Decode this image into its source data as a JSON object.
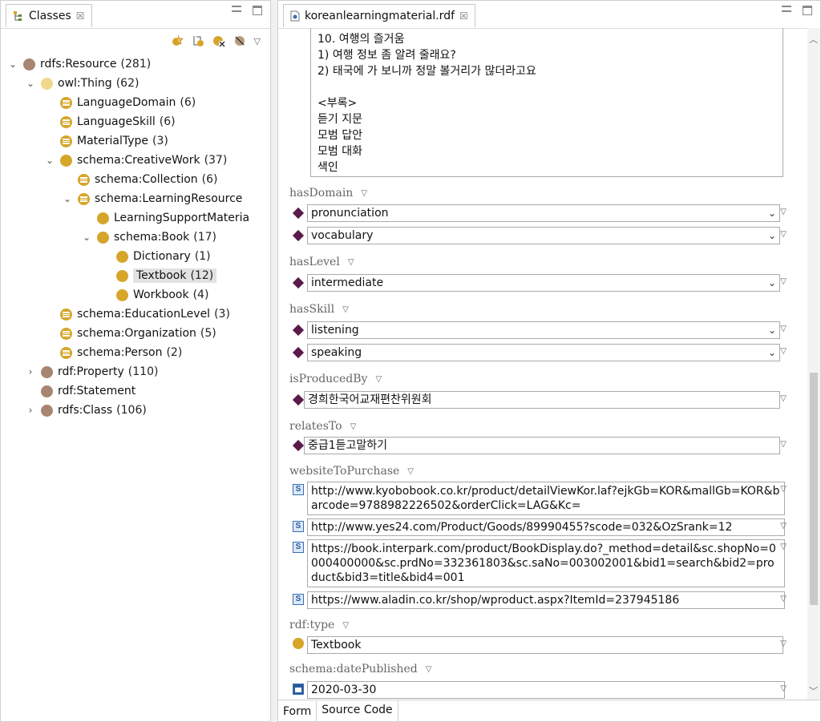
{
  "left_panel": {
    "tab_title": "Classes",
    "tab_close": "☒",
    "tree": [
      {
        "label": "rdfs:Resource",
        "count": "(281)",
        "twisty": "⌄",
        "icon": "brown",
        "depth": 0
      },
      {
        "label": "owl:Thing",
        "count": "(62)",
        "twisty": "⌄",
        "icon": "lightgold",
        "depth": 1
      },
      {
        "label": "LanguageDomain",
        "count": "(6)",
        "twisty": "",
        "icon": "list",
        "depth": 2
      },
      {
        "label": "LanguageSkill",
        "count": "(6)",
        "twisty": "",
        "icon": "list",
        "depth": 2
      },
      {
        "label": "MaterialType",
        "count": "(3)",
        "twisty": "",
        "icon": "list",
        "depth": 2
      },
      {
        "label": "schema:CreativeWork",
        "count": "(37)",
        "twisty": "⌄",
        "icon": "gold",
        "depth": 2
      },
      {
        "label": "schema:Collection",
        "count": "(6)",
        "twisty": "",
        "icon": "list",
        "depth": 3
      },
      {
        "label": "schema:LearningResource",
        "count": "",
        "twisty": "⌄",
        "icon": "list",
        "depth": 3
      },
      {
        "label": "LearningSupportMateria",
        "count": "",
        "twisty": "",
        "icon": "gold",
        "depth": 4
      },
      {
        "label": "schema:Book",
        "count": "(17)",
        "twisty": "⌄",
        "icon": "gold",
        "depth": 4
      },
      {
        "label": "Dictionary",
        "count": "(1)",
        "twisty": "",
        "icon": "gold",
        "depth": 5
      },
      {
        "label": "Textbook",
        "count": "(12)",
        "twisty": "",
        "icon": "gold",
        "depth": 5,
        "selected": true
      },
      {
        "label": "Workbook",
        "count": "(4)",
        "twisty": "",
        "icon": "gold",
        "depth": 5
      },
      {
        "label": "schema:EducationLevel",
        "count": "(3)",
        "twisty": "",
        "icon": "list",
        "depth": 2
      },
      {
        "label": "schema:Organization",
        "count": "(5)",
        "twisty": "",
        "icon": "list",
        "depth": 2
      },
      {
        "label": "schema:Person",
        "count": "(2)",
        "twisty": "",
        "icon": "list",
        "depth": 2
      },
      {
        "label": "rdf:Property",
        "count": "(110)",
        "twisty": "›",
        "icon": "brown",
        "depth": 1
      },
      {
        "label": "rdf:Statement",
        "count": "",
        "twisty": "",
        "icon": "brown",
        "depth": 1
      },
      {
        "label": "rdfs:Class",
        "count": "(106)",
        "twisty": "›",
        "icon": "brown",
        "depth": 1
      }
    ]
  },
  "right_panel": {
    "tab_title": "koreanlearningmaterial.rdf",
    "tab_close": "☒",
    "description_text": "10. 여행의 즐거움\n1) 여행 정보 좀 알려 줄래요?\n2) 태국에 가 보니까 정말 볼거리가 많더라고요\n\n<부록>\n듣기 지문\n모범 답안\n모범 대화\n색인",
    "properties": {
      "hasDomain": {
        "label": "hasDomain",
        "values": [
          "pronunciation",
          "vocabulary"
        ]
      },
      "hasLevel": {
        "label": "hasLevel",
        "values": [
          "intermediate"
        ]
      },
      "hasSkill": {
        "label": "hasSkill",
        "values": [
          "listening",
          "speaking"
        ]
      },
      "isProducedBy": {
        "label": "isProducedBy",
        "values": [
          "경희한국어교재편찬위원회"
        ]
      },
      "relatesTo": {
        "label": "relatesTo",
        "values": [
          "중급1듣고말하기"
        ]
      },
      "websiteToPurchase": {
        "label": "websiteToPurchase",
        "values": [
          "http://www.kyobobook.co.kr/product/detailViewKor.laf?ejkGb=KOR&mallGb=KOR&barcode=9788982226502&orderClick=LAG&Kc=",
          "http://www.yes24.com/Product/Goods/89990455?scode=032&OzSrank=12",
          "https://book.interpark.com/product/BookDisplay.do?_method=detail&sc.shopNo=0000400000&sc.prdNo=332361803&sc.saNo=003002001&bid1=search&bid2=product&bid3=title&bid4=001",
          "https://www.aladin.co.kr/shop/wproduct.aspx?ItemId=237945186"
        ]
      },
      "rdfType": {
        "label": "rdf:type",
        "values": [
          "Textbook"
        ]
      },
      "datePublished": {
        "label": "schema:datePublished",
        "values": [
          "2020-03-30"
        ]
      }
    },
    "bottom_tabs": [
      "Form",
      "Source Code"
    ]
  },
  "icons": {
    "combo_chevron": "⌄",
    "dropdown_triangle": "▽",
    "string_badge": "S"
  }
}
